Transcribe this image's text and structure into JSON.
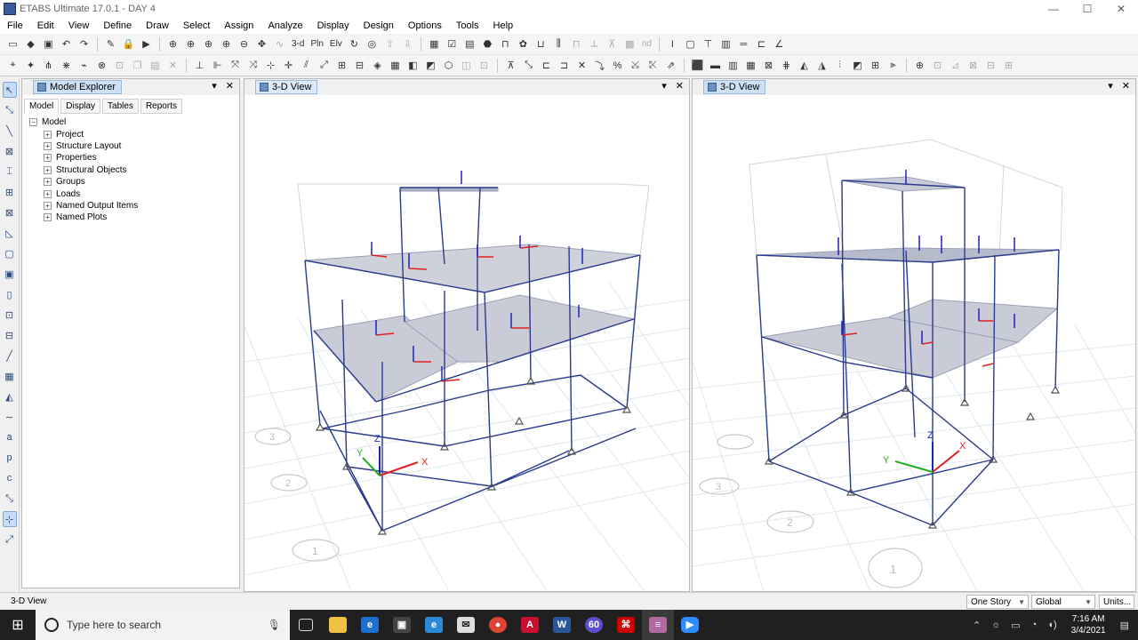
{
  "window": {
    "title": "ETABS Ultimate 17.0.1 - DAY 4",
    "min": "—",
    "max": "☐",
    "close": "✕"
  },
  "menu": [
    "File",
    "Edit",
    "View",
    "Define",
    "Draw",
    "Select",
    "Assign",
    "Analyze",
    "Display",
    "Design",
    "Options",
    "Tools",
    "Help"
  ],
  "toolbar1_text": {
    "three_d": "3-d",
    "plan": "Pln",
    "elev": "Elv",
    "nd": "nd"
  },
  "model_explorer": {
    "title": "Model Explorer",
    "tabs": [
      "Model",
      "Display",
      "Tables",
      "Reports"
    ],
    "root": "Model",
    "items": [
      "Project",
      "Structure Layout",
      "Properties",
      "Structural Objects",
      "Groups",
      "Loads",
      "Named Output Items",
      "Named Plots"
    ]
  },
  "view_left": {
    "title": "3-D View"
  },
  "view_right": {
    "title": "3-D View"
  },
  "panel_controls": {
    "dropdown": "▾",
    "close": "✕"
  },
  "axis_labels": {
    "x": "X",
    "y": "Y",
    "z": "Z"
  },
  "grid_labels_left": [
    "3",
    "2",
    "1"
  ],
  "grid_labels_right": [
    "3",
    "2",
    "1"
  ],
  "status": {
    "text": "3-D View",
    "story": "One Story",
    "coord": "Global",
    "units": "Units..."
  },
  "taskbar": {
    "search_placeholder": "Type here to search",
    "time": "7:16 AM",
    "date": "3/4/2021",
    "badge": "60"
  },
  "colors": {
    "frame": "#2a3a8c",
    "slab": "#c9ccd6",
    "x_axis": "#e02020",
    "y_axis": "#20b020",
    "z_axis": "#2020c0"
  }
}
